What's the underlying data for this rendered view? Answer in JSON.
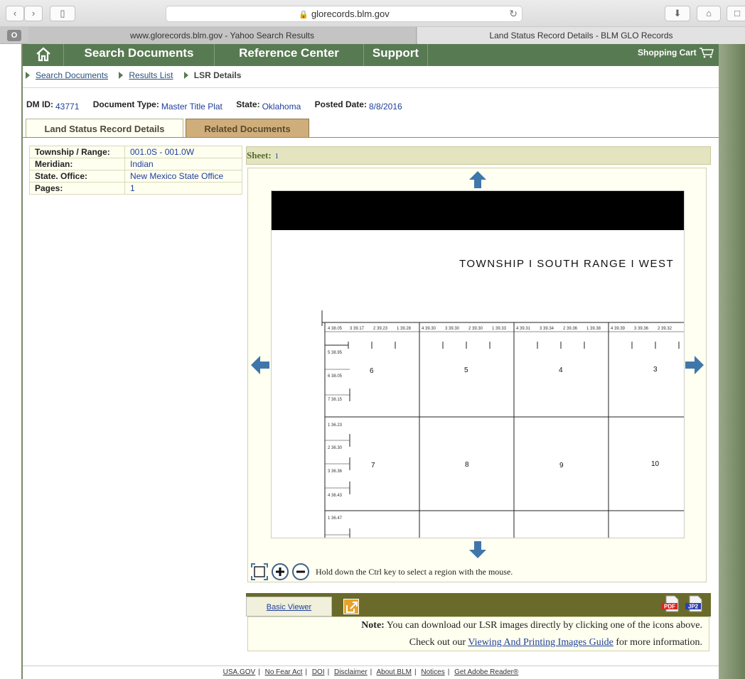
{
  "browser": {
    "url": "glorecords.blm.gov",
    "tabs": [
      {
        "label": "www.glorecords.blm.gov - Yahoo Search Results"
      },
      {
        "label": "Land Status Record Details - BLM GLO Records"
      }
    ],
    "tab_badge": "O"
  },
  "nav": {
    "items": [
      "Search Documents",
      "Reference Center",
      "Support"
    ],
    "cart": "Shopping Cart"
  },
  "breadcrumb": {
    "link1": "Search Documents",
    "link2": "Results List",
    "current": "LSR Details"
  },
  "meta": {
    "dm_id_label": "DM ID:",
    "dm_id": "43771",
    "doc_type_label": "Document Type:",
    "doc_type": "Master Title Plat",
    "state_label": "State:",
    "state": "Oklahoma",
    "posted_label": "Posted Date:",
    "posted": "8/8/2016"
  },
  "tabs": {
    "details": "Land Status Record Details",
    "related": "Related Documents"
  },
  "details": [
    {
      "key": "Township / Range:",
      "value": "001.0S - 001.0W"
    },
    {
      "key": "Meridian:",
      "value": "Indian"
    },
    {
      "key": "State. Office:",
      "value": "New Mexico State Office"
    },
    {
      "key": "Pages:",
      "value": "1"
    }
  ],
  "sheet": {
    "label": "Sheet:",
    "number": "1"
  },
  "image": {
    "title": "TOWNSHIP  I  SOUTH    RANGE  I  WEST",
    "sections_row1": [
      "6",
      "5",
      "4",
      "3"
    ],
    "sections_row2": [
      "7",
      "8",
      "9",
      "10"
    ],
    "top_lots": [
      "4 38.05",
      "3 39.17",
      "2 39.23",
      "1 39.28",
      "4 39.30",
      "3 39.30",
      "2 39.30",
      "1 39.33",
      "4 39.31",
      "3 39.34",
      "2 39.36",
      "1 39.38",
      "4 39.39",
      "3 39.36",
      "2 39.32"
    ],
    "side_lots": [
      "5 38.95",
      "6 38.05",
      "7 38.15",
      "1 36.23",
      "2 36.30",
      "3 36.36",
      "4 36.43",
      "1 36.47"
    ]
  },
  "viewer": {
    "hint": "Hold down the Ctrl key to select a region with the mouse.",
    "basic_viewer": "Basic Viewer",
    "pdf": "PDF",
    "jp2": "JP2"
  },
  "note": {
    "bold": "Note:",
    "line1": "You can download our LSR images directly by clicking one of the icons above.",
    "line2_pre": "Check out our",
    "line2_link": "Viewing And Printing Images Guide",
    "line2_post": "for more information."
  },
  "footer": [
    "USA.GOV",
    "No Fear Act",
    "DOI",
    "Disclaimer",
    "About BLM",
    "Notices",
    "Get Adobe Reader®"
  ]
}
